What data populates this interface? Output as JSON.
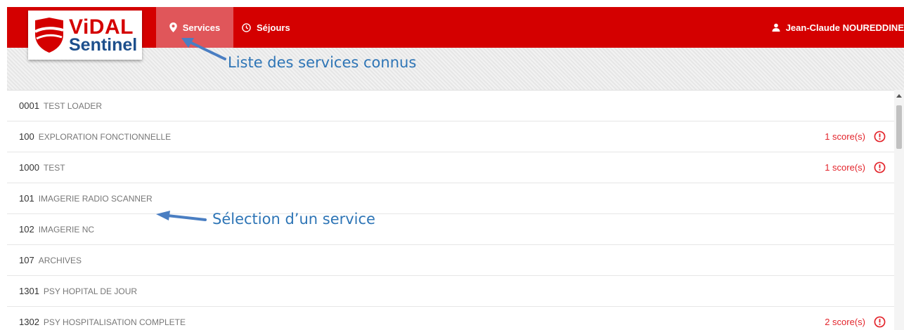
{
  "logo": {
    "brand_top": "ViDAL",
    "brand_bottom": "Sentinel"
  },
  "nav": {
    "tabs": [
      {
        "label": "Services",
        "icon": "map-marker-icon",
        "active": true
      },
      {
        "label": "Séjours",
        "icon": "clock-icon",
        "active": false
      }
    ],
    "user_name": "Jean-Claude NOUREDDINE"
  },
  "annotations": {
    "services_note": "Liste des services connus",
    "selection_note": "Sélection d’un service"
  },
  "services": [
    {
      "code": "0001",
      "name": "TEST LOADER",
      "score": ""
    },
    {
      "code": "100",
      "name": "EXPLORATION FONCTIONNELLE",
      "score": "1 score(s)"
    },
    {
      "code": "1000",
      "name": "TEST",
      "score": "1 score(s)"
    },
    {
      "code": "101",
      "name": "IMAGERIE RADIO SCANNER",
      "score": ""
    },
    {
      "code": "102",
      "name": "IMAGERIE NC",
      "score": ""
    },
    {
      "code": "107",
      "name": "ARCHIVES",
      "score": ""
    },
    {
      "code": "1301",
      "name": "PSY HOPITAL DE JOUR",
      "score": ""
    },
    {
      "code": "1302",
      "name": "PSY HOSPITALISATION COMPLETE",
      "score": "2 score(s)"
    }
  ],
  "colors": {
    "brand_red": "#d40000",
    "active_tab": "#e0565a",
    "annotation_blue": "#2e75b6",
    "alert_red": "#e3242b"
  }
}
